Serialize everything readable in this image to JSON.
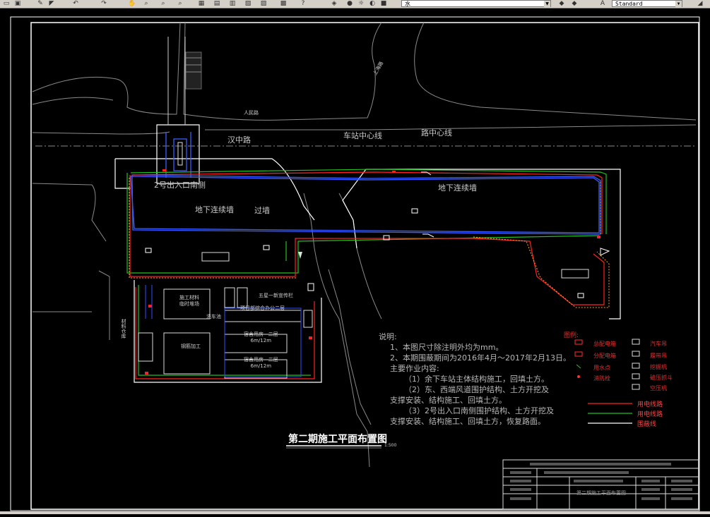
{
  "toolbar": {
    "layer_value": "水",
    "text_style_value": "Standard"
  },
  "labels": {
    "hanzhong_road": "汉中路",
    "station_center_line": "车站中心线",
    "road_center_line": "路中心线",
    "renmin_road": "人民路",
    "exit2_south": "2号出入口南侧",
    "diaphragm_wall_1": "地下连续墙",
    "diaphragm_wall_2": "地下连续墙",
    "guide_wall": "过墙",
    "north_road": "上海路"
  },
  "notes": {
    "header": "说明:",
    "line1": "1、本图尺寸除注明外均为mm。",
    "line2": "2、本期围蔽期间为2016年4月～2017年2月13日。",
    "line3": "主要作业内容:",
    "line4": "（1）余下车站主体结构施工，回填土方。",
    "line5": "（2）东、西端风道围护结构、土方开挖及",
    "line6": "支撑安装、结构施工、回填土方。",
    "line7": "（3）2号出入口南侧围护结构、土方开挖及",
    "line8": "支撑安装、结构施工、回填土方，恢复路面。"
  },
  "legend": {
    "title": "图例:",
    "items": [
      "总配电箱",
      "分配电箱",
      "用水点",
      "消防栓"
    ],
    "items_right": [
      "汽车吊",
      "履带吊",
      "挖掘机",
      "破压抓斗",
      "空压机"
    ],
    "lines": [
      "用电线路",
      "用电线路",
      "围蔽线"
    ]
  },
  "drawing": {
    "title": "第二期施工平面布置图",
    "scale": "1:500",
    "titleblock_name": "第二期施工平面布置图"
  },
  "site_labels": {
    "material_area": "施工材料\n临时堆场",
    "steel_area": "钢筋加工",
    "office": "项目部综合办公二层",
    "dorm1": "宿舍用房   二层\n6m/12m",
    "dorm2": "宿舍用房   二层\n6m/12m",
    "fivestar": "五星一新宣传栏",
    "wash": "洗车池",
    "side": "材料仓库"
  },
  "colors": {
    "power_line": "#ff2020",
    "water_line": "#20c020",
    "fence_line": "#ffffff",
    "wall_line": "#3050ff",
    "cad_bg": "#000000"
  }
}
